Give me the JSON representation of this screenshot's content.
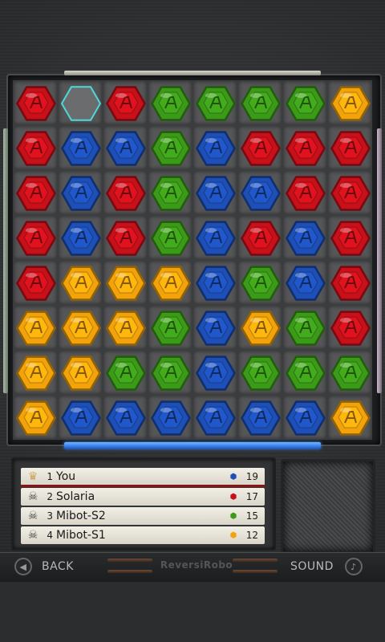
{
  "colors": {
    "red": "#c8101a",
    "blue": "#1d4fb6",
    "green": "#3c9a19",
    "yellow": "#f2a30c",
    "board_cell": "#555658",
    "highlight": "#4fd8d8"
  },
  "board": {
    "rows": [
      [
        "red",
        "highlight",
        "red",
        "green",
        "green",
        "green",
        "green",
        "yellow"
      ],
      [
        "red",
        "blue",
        "blue",
        "green",
        "blue",
        "red",
        "red",
        "red"
      ],
      [
        "red",
        "blue",
        "red",
        "green",
        "blue",
        "blue",
        "red",
        "red"
      ],
      [
        "red",
        "blue",
        "red",
        "green",
        "blue",
        "red",
        "blue",
        "red"
      ],
      [
        "red",
        "yellow",
        "yellow",
        "yellow",
        "blue",
        "green",
        "blue",
        "red"
      ],
      [
        "yellow",
        "yellow",
        "yellow",
        "green",
        "blue",
        "yellow",
        "green",
        "red"
      ],
      [
        "yellow",
        "yellow",
        "green",
        "green",
        "blue",
        "green",
        "green",
        "green"
      ],
      [
        "yellow",
        "blue",
        "blue",
        "blue",
        "blue",
        "blue",
        "blue",
        "yellow"
      ]
    ]
  },
  "scoreboard": {
    "players": [
      {
        "rank": "1",
        "name": "You",
        "icon": "chef-icon",
        "gem_color": "#1d4fb6",
        "score": "19"
      },
      {
        "rank": "2",
        "name": "Solaria",
        "icon": "skull-icon",
        "gem_color": "#c8101a",
        "score": "17"
      },
      {
        "rank": "3",
        "name": "Mibot-S2",
        "icon": "skull-icon",
        "gem_color": "#3c9a19",
        "score": "15"
      },
      {
        "rank": "4",
        "name": "Mibot-S1",
        "icon": "skull-icon",
        "gem_color": "#f2a30c",
        "score": "12"
      }
    ]
  },
  "toolbar": {
    "back_label": "BACK",
    "sound_label": "SOUND",
    "brand": "ReversiRobo"
  }
}
